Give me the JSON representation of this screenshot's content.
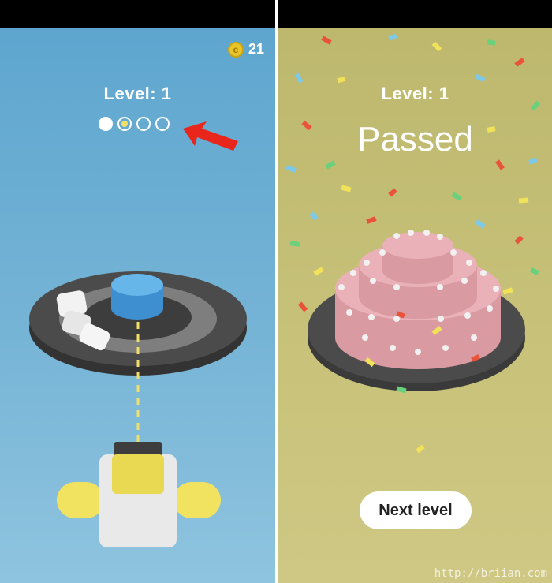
{
  "left_panel": {
    "coins": "21",
    "coin_icon": "coin-icon",
    "level_label": "Level: 1",
    "progress_dots": [
      "filled",
      "current",
      "empty",
      "empty"
    ],
    "annotation": "red-arrow-icon"
  },
  "right_panel": {
    "level_label": "Level: 1",
    "status": "Passed",
    "next_button_label": "Next level",
    "watermark": "http://briian.com"
  },
  "colors": {
    "left_bg": "#6fb0d4",
    "right_bg": "#c5bf78",
    "cake": "#e3a6ad",
    "plate": "#4b4b4b",
    "accent_yellow": "#f0e06a"
  }
}
